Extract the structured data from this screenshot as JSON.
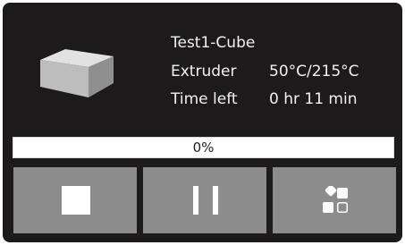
{
  "job": {
    "name": "Test1-Cube",
    "extruder_label": "Extruder",
    "extruder_value": "50°C/215°C",
    "time_label": "Time left",
    "time_value": "0 hr 11 min"
  },
  "progress": {
    "percent": 0,
    "text": "0%"
  },
  "icons": {
    "thumbnail": "cube-thumbnail-icon",
    "stop": "stop-icon",
    "pause": "pause-icon",
    "more": "more-options-icon"
  },
  "colors": {
    "panel_background": "#1c1a1a",
    "button_background": "#8c8c8c",
    "text": "#f2f2f2",
    "progress_background": "#ffffff"
  }
}
